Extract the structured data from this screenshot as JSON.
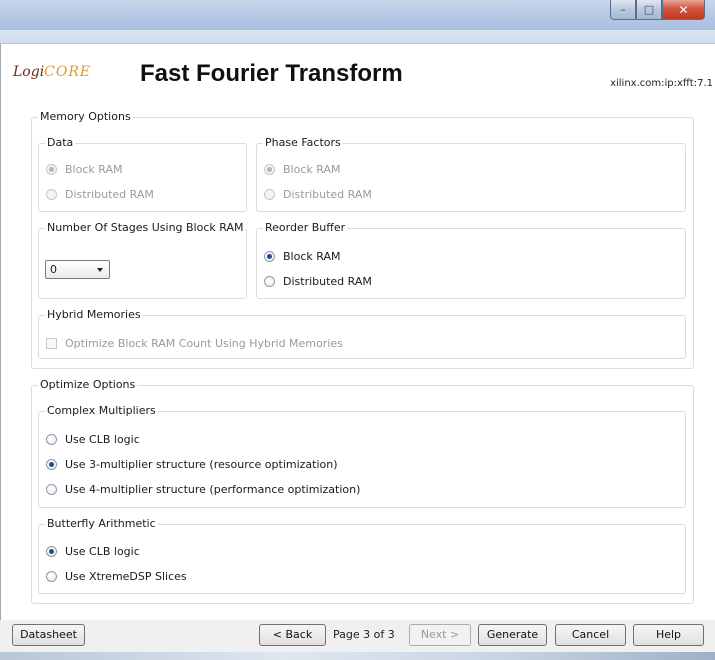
{
  "window": {
    "minimize_glyph": "–",
    "maximize_glyph": "□",
    "close_glyph": "✕"
  },
  "header": {
    "logo_prefix": "Logi",
    "logo_suffix": "CORE",
    "title": "Fast Fourier Transform",
    "ip_id": "xilinx.com:ip:xfft:7.1"
  },
  "memory_options": {
    "legend": "Memory Options",
    "data": {
      "legend": "Data",
      "options": [
        "Block RAM",
        "Distributed RAM"
      ],
      "selected": "Block RAM",
      "enabled": false
    },
    "phase_factors": {
      "legend": "Phase Factors",
      "options": [
        "Block RAM",
        "Distributed RAM"
      ],
      "selected": "Block RAM",
      "enabled": false
    },
    "stages": {
      "legend": "Number Of Stages Using Block RAM",
      "value": "0"
    },
    "reorder_buffer": {
      "legend": "Reorder Buffer",
      "options": [
        "Block RAM",
        "Distributed RAM"
      ],
      "selected": "Block RAM",
      "enabled": true
    },
    "hybrid": {
      "legend": "Hybrid Memories",
      "checkbox_label": "Optimize Block RAM Count Using Hybrid Memories",
      "checked": false,
      "enabled": false
    }
  },
  "optimize_options": {
    "legend": "Optimize Options",
    "complex_multipliers": {
      "legend": "Complex Multipliers",
      "options": [
        "Use CLB logic",
        "Use 3-multiplier structure (resource optimization)",
        "Use 4-multiplier structure (performance optimization)"
      ],
      "selected": "Use 3-multiplier structure (resource optimization)"
    },
    "butterfly": {
      "legend": "Butterfly Arithmetic",
      "options": [
        "Use CLB logic",
        "Use XtremeDSP Slices"
      ],
      "selected": "Use CLB logic"
    }
  },
  "footer": {
    "datasheet": "Datasheet",
    "back": "< Back",
    "page_info": "Page 3 of 3",
    "next": "Next >",
    "generate": "Generate",
    "cancel": "Cancel",
    "help": "Help"
  }
}
